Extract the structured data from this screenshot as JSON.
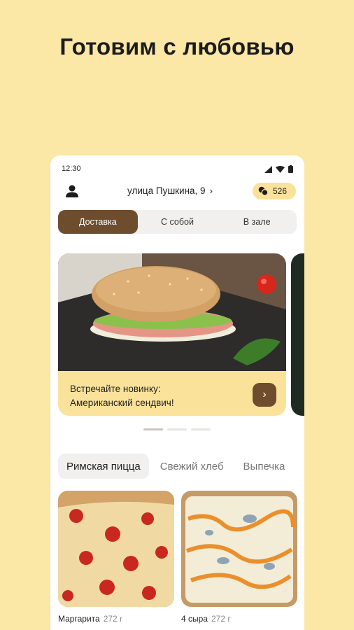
{
  "headline": "Готовим с любовью",
  "status": {
    "time": "12:30"
  },
  "header": {
    "address": "улица Пушкина, 9",
    "bonus_points": "526"
  },
  "order_modes": [
    "Доставка",
    "С собой",
    "В зале"
  ],
  "banner": {
    "line1": "Встречайте новинку:",
    "line2": "Американский сендвич!"
  },
  "categories": [
    "Римская пицца",
    "Свежий хлеб",
    "Выпечка"
  ],
  "products": [
    {
      "name": "Маргарита",
      "weight": "272 г"
    },
    {
      "name": "4 сыра",
      "weight": "272 г"
    }
  ],
  "colors": {
    "background": "#fbe7a6",
    "accent": "#6e4c2e",
    "highlight": "#fbe29a"
  }
}
